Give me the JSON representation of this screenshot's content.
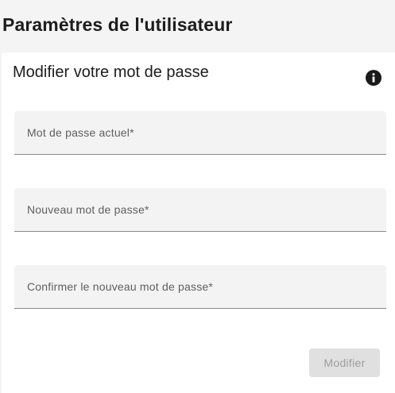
{
  "page": {
    "title": "Paramètres de l'utilisateur"
  },
  "password_card": {
    "title": "Modifier votre mot de passe",
    "info_icon": "info-icon",
    "fields": {
      "current_password": {
        "placeholder": "Mot de passe actuel*",
        "value": ""
      },
      "new_password": {
        "placeholder": "Nouveau mot de passe*",
        "value": ""
      },
      "confirm_password": {
        "placeholder": "Confirmer le nouveau mot de passe*",
        "value": ""
      }
    },
    "submit_label": "Modifier",
    "submit_disabled": true
  },
  "colors": {
    "background": "#f4f4f4",
    "card": "#ffffff",
    "field_fill": "#f3f3f3",
    "button_disabled_bg": "#e0e0e0",
    "button_disabled_text": "#9e9e9e"
  }
}
